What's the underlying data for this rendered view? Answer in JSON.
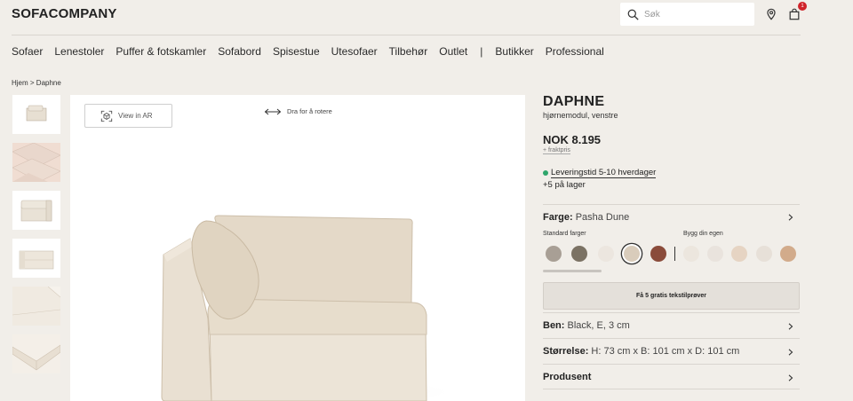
{
  "header": {
    "logo": "SOFACOMPANY",
    "search_placeholder": "Søk",
    "cart_count": "1"
  },
  "nav": {
    "items": [
      "Sofaer",
      "Lenestoler",
      "Puffer & fotskamler",
      "Sofabord",
      "Spisestue",
      "Utesofaer",
      "Tilbehør",
      "Outlet"
    ],
    "separator": "|",
    "extra": [
      "Butikker",
      "Professional"
    ]
  },
  "breadcrumb": "Hjem > Daphne",
  "viewer": {
    "ar_label": "View in AR",
    "rotate_hint": "Dra for å rotere"
  },
  "product": {
    "name": "DAPHNE",
    "subtitle": "hjørnemodul, venstre",
    "price": "NOK 8.195",
    "freight": "+ fraktpris",
    "delivery": "Leveringstid 5-10 hverdager",
    "stock": "+5 på lager",
    "color_label": "Farge:",
    "color_value": "Pasha Dune",
    "standard_colors_label": "Standard farger",
    "custom_colors_label": "Bygg din egen",
    "standard_swatches": [
      "#a89f95",
      "#7b7264",
      "#ece6df",
      "#d9ccbb",
      "#8a4b3a"
    ],
    "custom_swatches": [
      "#ece6de",
      "#e9e3dd",
      "#e6d4c3",
      "#e7e0d8",
      "#d2ab8b"
    ],
    "samples_button": "Få 5 gratis tekstilprøver",
    "legs_label": "Ben:",
    "legs_value": "Black, E, 3 cm",
    "size_label": "Størrelse:",
    "size_value": "H: 73 cm x B: 101 cm x D: 101 cm",
    "producer_label": "Produsent"
  },
  "colors": {
    "background": "#f1eee9",
    "in_stock": "#2fa66b",
    "badge": "#d0232a"
  }
}
